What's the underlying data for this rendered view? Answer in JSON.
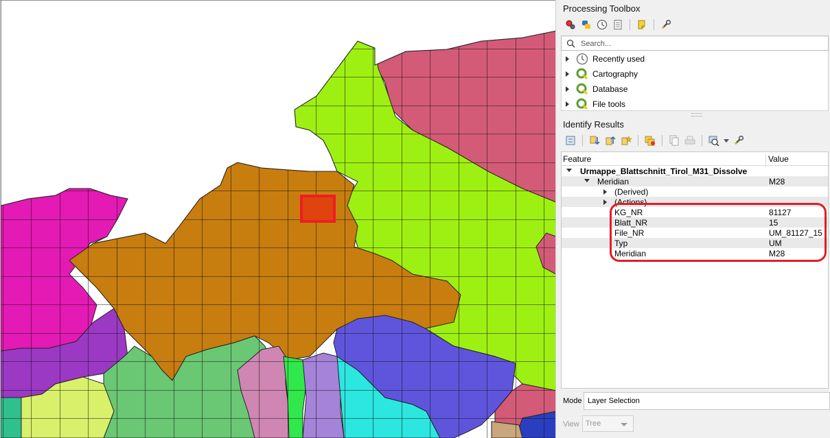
{
  "colors": {
    "white_area": "#ffffff",
    "green_region": "#9ef012",
    "orange_region": "#c87d0f",
    "rose_region": "#d35b78",
    "magenta_region": "#e41ab5",
    "purple_region": "#9b39c4",
    "blue_region": "#5f55dc",
    "light_green_region": "#6ac774",
    "pale_pink_region": "#d086b2",
    "lilac_region": "#a483d8",
    "cyan_region": "#2ce6e0",
    "lime_region": "#d9f06b",
    "teal_region": "#2fc08e",
    "bright_green_region": "#30e84c",
    "selection_red": "#ee1d23",
    "highlight_red": "#e01e24"
  },
  "toolbox": {
    "title": "Processing Toolbox",
    "toolbar_icons": [
      "gear-cluster-icon",
      "python-icon",
      "clock-icon",
      "document-icon",
      "edit-icon",
      "wrench-icon"
    ],
    "search_placeholder": "Search...",
    "items": [
      {
        "label": "Recently used",
        "icon": "clock-icon"
      },
      {
        "label": "Cartography",
        "icon": "qgis-icon"
      },
      {
        "label": "Database",
        "icon": "qgis-icon"
      },
      {
        "label": "File tools",
        "icon": "qgis-icon"
      }
    ]
  },
  "identify": {
    "title": "Identify Results",
    "toolbar_icons": [
      "expand-icon",
      "expand-all-icon",
      "collapse-all-icon",
      "expand-new-icon",
      "clear-highlight-icon",
      "copy-icon",
      "print-icon",
      "identify-mode-icon",
      "dropdown-icon",
      "settings-icon"
    ],
    "columns": {
      "feature": "Feature",
      "value": "Value"
    },
    "layer": "Urmappe_Blattschnitt_Tirol_M31_Dissolve",
    "feature": {
      "name": "Meridian",
      "value": "M28"
    },
    "groups": [
      "(Derived)",
      "(Actions)"
    ],
    "attributes": [
      {
        "name": "KG_NR",
        "value": "81127"
      },
      {
        "name": "Blatt_NR",
        "value": "15"
      },
      {
        "name": "File_NR",
        "value": "UM_81127_15"
      },
      {
        "name": "Typ",
        "value": "UM"
      },
      {
        "name": "Meridian",
        "value": "M28"
      }
    ],
    "mode_label": "Mode",
    "mode_value": "Layer Selection",
    "view_label": "View",
    "view_value": "Tree"
  }
}
